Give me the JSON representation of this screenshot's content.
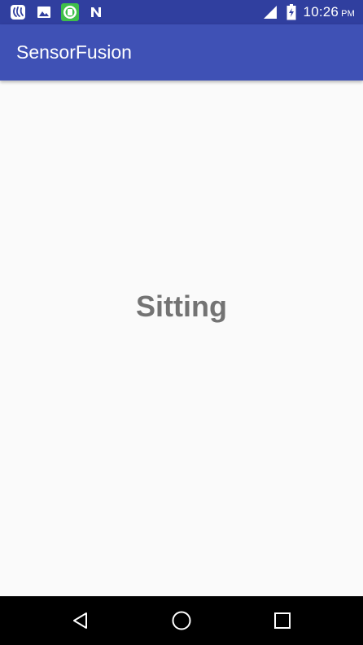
{
  "status_bar": {
    "time": "10:26",
    "ampm": "PM",
    "icons": [
      "saavn-icon",
      "image-icon",
      "whatsapp-icon",
      "n-app-icon",
      "signal-icon",
      "battery-icon"
    ]
  },
  "app_bar": {
    "title": "SensorFusion"
  },
  "content": {
    "activity": "Sitting"
  },
  "nav_bar": {
    "buttons": [
      "back-button",
      "home-button",
      "recents-button"
    ]
  },
  "colors": {
    "status_bar": "#303f9f",
    "app_bar": "#3f51b5",
    "background": "#fafafa",
    "activity_text": "#737373"
  }
}
